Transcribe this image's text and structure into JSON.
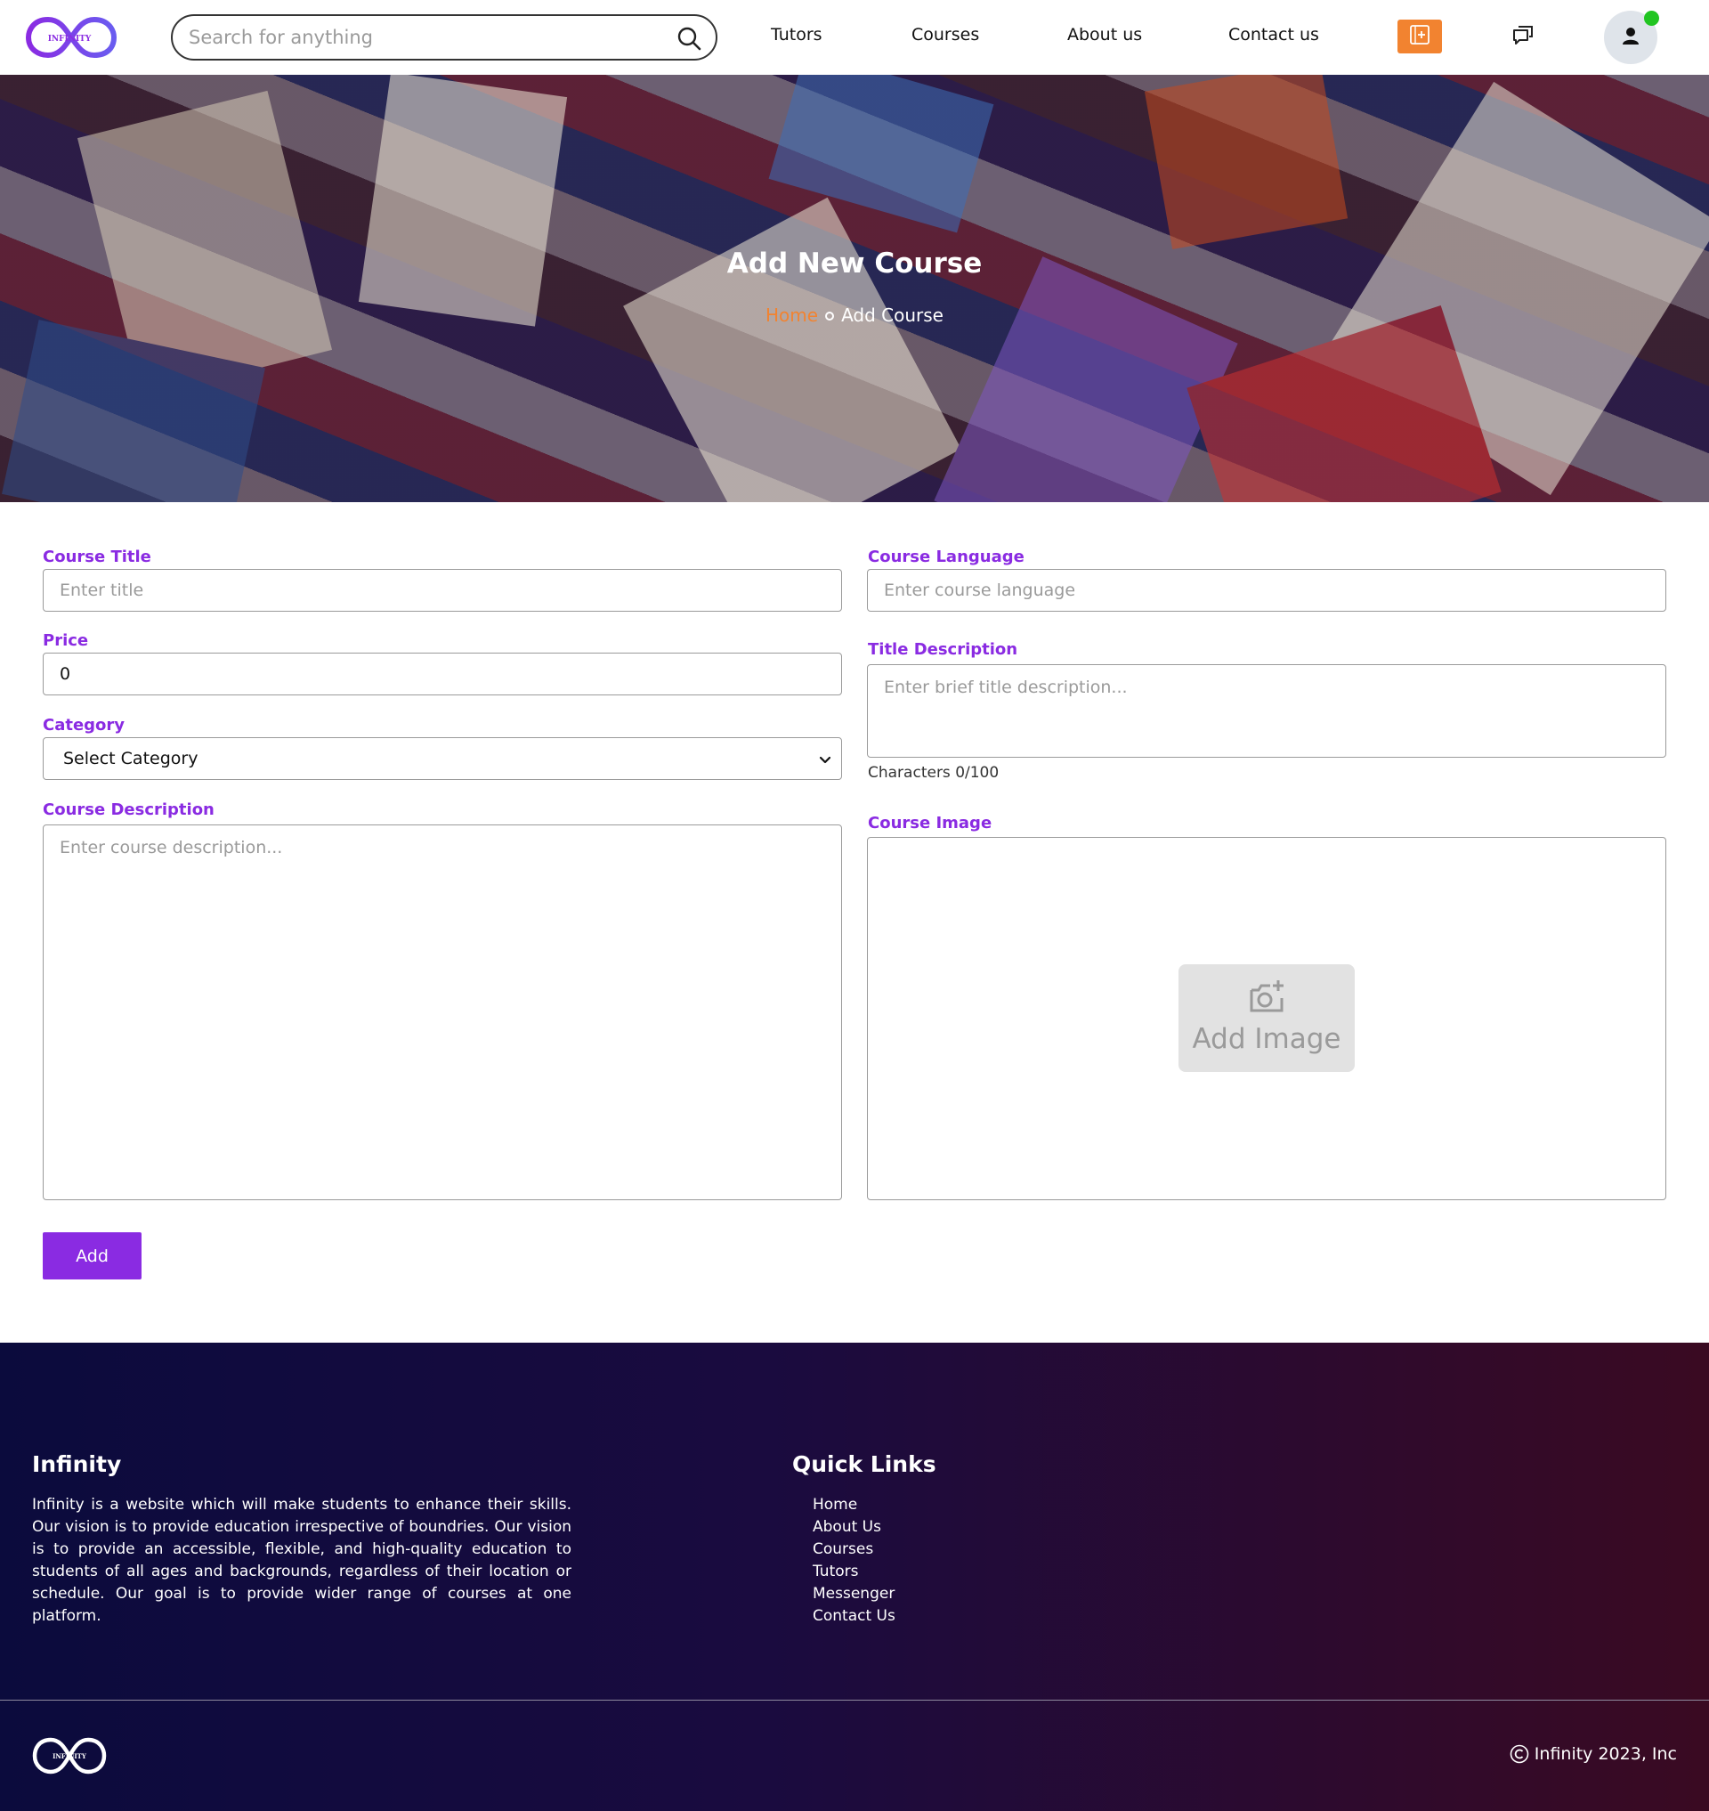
{
  "header": {
    "logo_text": "INFINITY",
    "search_placeholder": "Search for anything",
    "nav": [
      "Tutors",
      "Courses",
      "About us",
      "Contact us"
    ],
    "icons": {
      "search": "search-icon",
      "create": "add-course-icon",
      "chat": "chat-icon",
      "user": "user-icon"
    },
    "colors": {
      "accent": "#8a2be2",
      "orange": "#f28330",
      "online": "#21c521"
    }
  },
  "hero": {
    "title": "Add New Course",
    "breadcrumb": {
      "home": "Home",
      "current": "Add Course"
    }
  },
  "form": {
    "course_title": {
      "label": "Course Title",
      "placeholder": "Enter title"
    },
    "price": {
      "label": "Price",
      "value": "0"
    },
    "category": {
      "label": "Category",
      "selected": "Select Category"
    },
    "course_description": {
      "label": "Course Description",
      "placeholder": "Enter course description..."
    },
    "course_language": {
      "label": "Course Language",
      "placeholder": "Enter course language"
    },
    "title_description": {
      "label": "Title Description",
      "placeholder": "Enter brief title description...",
      "char_count": "Characters 0/100"
    },
    "course_image": {
      "label": "Course Image",
      "add_label": "Add Image"
    },
    "submit_label": "Add"
  },
  "footer": {
    "brand_title": "Infinity",
    "about": "Infinity is a website which will make students to enhance their skills. Our vision is to provide education irrespective of boundries. Our vision is to provide an accessible, flexible, and high-quality education to students of all ages and backgrounds, regardless of their location or schedule. Our goal is to provide wider range of courses at one platform.",
    "quick_links_title": "Quick Links",
    "quick_links": [
      "Home",
      "About Us",
      "Courses",
      "Tutors",
      "Messenger",
      "Contact Us"
    ],
    "logo_text": "INFINITY",
    "copyright": "Infinity 2023, Inc"
  }
}
